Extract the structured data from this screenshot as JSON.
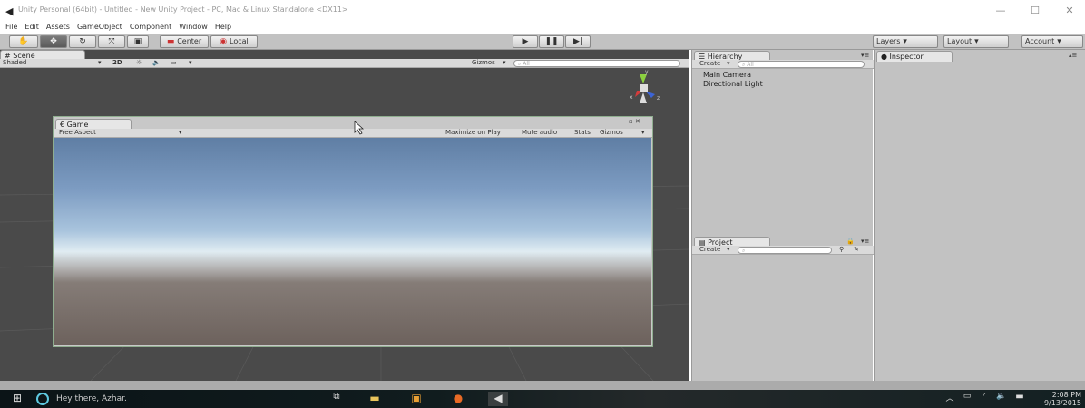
{
  "window": {
    "title": "Unity Personal (64bit) - Untitled - New Unity Project - PC, Mac & Linux Standalone <DX11>",
    "minimize": "—",
    "maximize": "☐",
    "close": "✕"
  },
  "menu": [
    "File",
    "Edit",
    "Assets",
    "GameObject",
    "Component",
    "Window",
    "Help"
  ],
  "toolbar": {
    "pivot_label": "Center",
    "space_label": "Local",
    "layers_label": "Layers",
    "layout_label": "Layout",
    "account_label": "Account"
  },
  "scene": {
    "tab_label": "Scene",
    "shading_mode": "Shaded",
    "mode_2d": "2D",
    "gizmos_label": "Gizmos",
    "search_placeholder": "All",
    "axis_x": "x",
    "axis_y": "y",
    "axis_z": "z"
  },
  "game": {
    "tab_label": "Game",
    "aspect": "Free Aspect",
    "maximize_label": "Maximize on Play",
    "mute_label": "Mute audio",
    "stats_label": "Stats",
    "gizmos_label": "Gizmos"
  },
  "hierarchy": {
    "tab_label": "Hierarchy",
    "create_label": "Create",
    "search_placeholder": "All",
    "items": [
      "Main Camera",
      "Directional Light"
    ]
  },
  "project": {
    "tab_label": "Project",
    "create_label": "Create"
  },
  "inspector": {
    "tab_label": "Inspector"
  },
  "taskbar": {
    "cortana_text": "Hey there, Azhar.",
    "time": "2:08 PM",
    "date": "9/13/2015"
  },
  "colors": {
    "unity_panel": "#c2c2c2",
    "scene_bg": "#4a4a4a",
    "taskbar": "#101c1e"
  }
}
